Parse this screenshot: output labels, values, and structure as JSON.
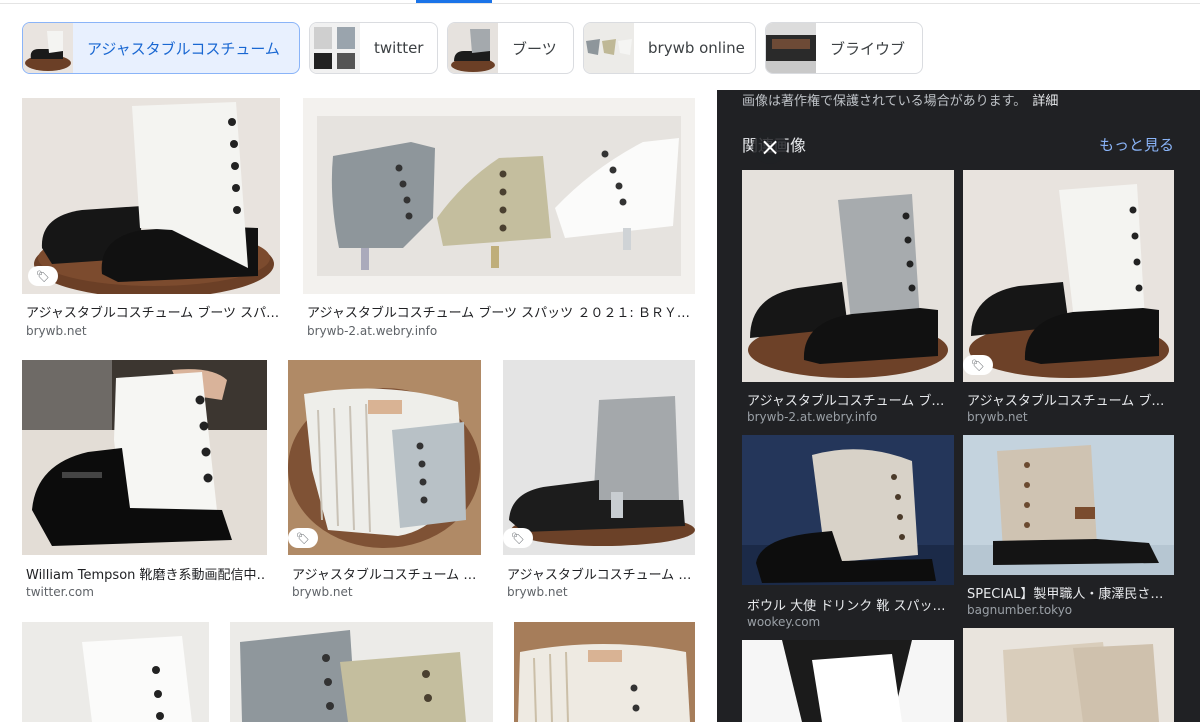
{
  "colors": {
    "accent": "#1a73e8",
    "panel_bg": "#202124",
    "link": "#8ab4f8"
  },
  "chips": [
    {
      "label": "アジャスタブルコスチューム",
      "active": true
    },
    {
      "label": "twitter",
      "active": false
    },
    {
      "label": "ブーツ",
      "active": false
    },
    {
      "label": "brywb online",
      "active": false
    },
    {
      "label": "ブライウブ",
      "active": false
    }
  ],
  "results": [
    {
      "caption": "アジャスタブルコスチューム ブーツ スパ…",
      "source": "brywb.net"
    },
    {
      "caption": "アジャスタブルコスチューム ブーツ スパッツ ２０２１: ＢＲＹ…",
      "source": "brywb-2.at.webry.info"
    },
    {
      "caption": "William Tempson 靴磨き系動画配信中…",
      "source": "twitter.com"
    },
    {
      "caption": "アジャスタブルコスチューム …",
      "source": "brywb.net"
    },
    {
      "caption": "アジャスタブルコスチューム …",
      "source": "brywb.net"
    }
  ],
  "panel": {
    "notice": "画像は著作権で保護されている場合があります。",
    "notice_link": "詳細",
    "related_title": "関連画像",
    "more_link": "もっと見る",
    "close_icon": "×",
    "related": [
      {
        "caption": "アジャスタブルコスチューム ブ…",
        "source": "brywb-2.at.webry.info"
      },
      {
        "caption": "アジャスタブルコスチューム ブ…",
        "source": "brywb.net"
      },
      {
        "caption": "ボウル 大使 ドリンク 靴 スパッ…",
        "source": "wookey.com"
      },
      {
        "caption": "SPECIAL】製甲職人・康澤民さ…",
        "source": "bagnumber.tokyo"
      }
    ]
  }
}
